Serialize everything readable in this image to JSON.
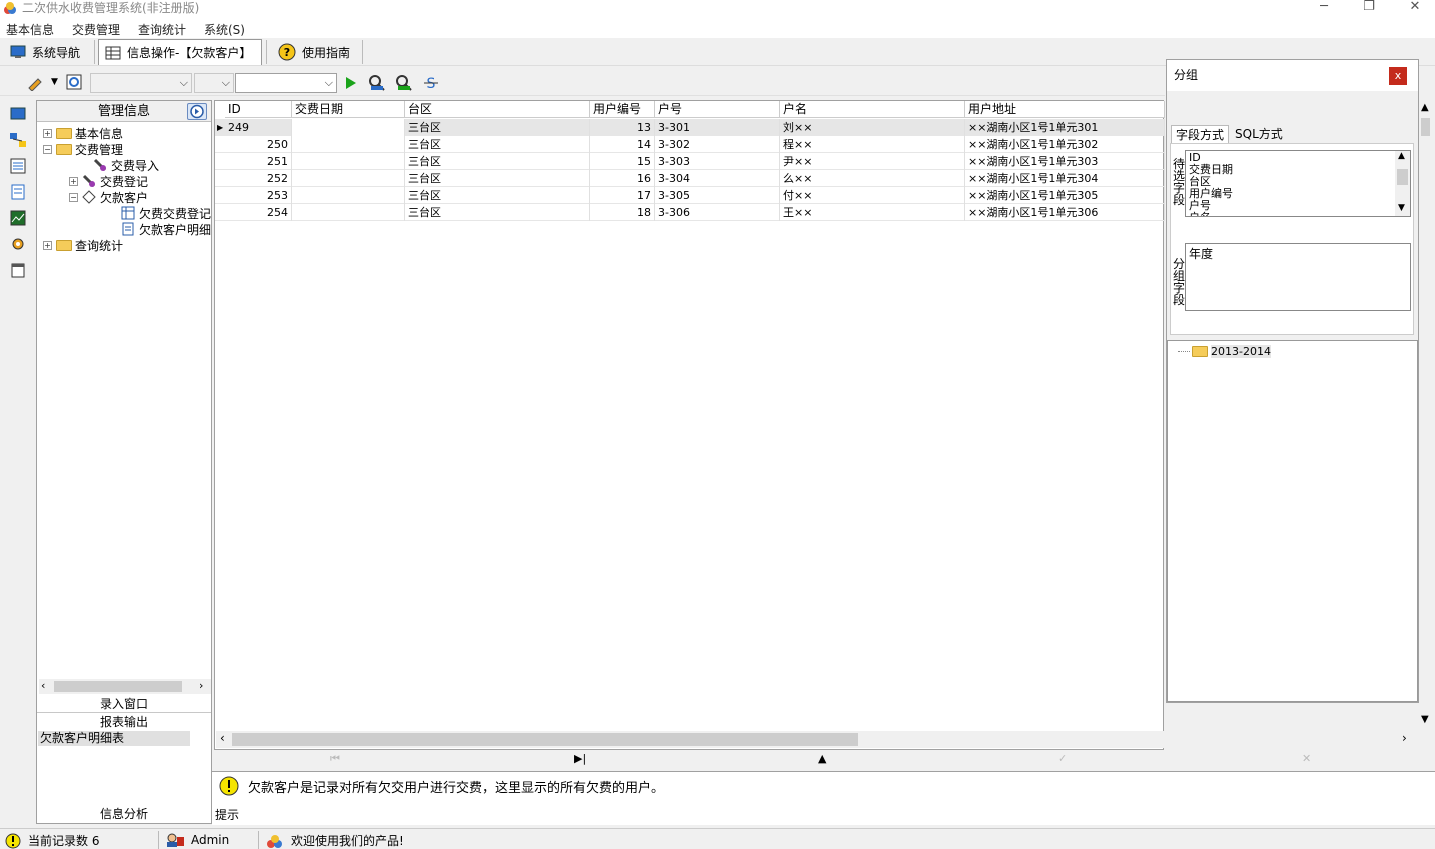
{
  "window": {
    "title": "二次供水收费管理系统(非注册版)",
    "minimize": "─",
    "maximize": "❐",
    "close": "✕"
  },
  "menu": [
    "基本信息",
    "交费管理",
    "查询统计",
    "系统(S)"
  ],
  "tabs": [
    {
      "label": "系统导航"
    },
    {
      "label": "信息操作-【欠款客户】"
    },
    {
      "label": "使用指南"
    }
  ],
  "nav": {
    "header": "管理信息",
    "tree": {
      "n1": "基本信息",
      "n2": "交费管理",
      "n2a": "交费导入",
      "n2b": "交费登记",
      "n2c": "欠款客户",
      "n2c1": "欠费交费登记",
      "n2c2": "欠款客户明细",
      "n3": "查询统计"
    },
    "section1": "录入窗口",
    "section2": "报表输出",
    "selected_report": "欠款客户明细表",
    "section3": "信息分析"
  },
  "grid": {
    "columns": [
      "ID",
      "交费日期",
      "台区",
      "用户编号",
      "户号",
      "户名",
      "用户地址"
    ],
    "rows": [
      {
        "id": "249",
        "date": "",
        "area": "三台区",
        "no": "13",
        "unit": "3-301",
        "name": "刘××",
        "addr": "××湖南小区1号1单元301"
      },
      {
        "id": "250",
        "date": "",
        "area": "三台区",
        "no": "14",
        "unit": "3-302",
        "name": "程××",
        "addr": "××湖南小区1号1单元302"
      },
      {
        "id": "251",
        "date": "",
        "area": "三台区",
        "no": "15",
        "unit": "3-303",
        "name": "尹××",
        "addr": "××湖南小区1号1单元303"
      },
      {
        "id": "252",
        "date": "",
        "area": "三台区",
        "no": "16",
        "unit": "3-304",
        "name": "么××",
        "addr": "××湖南小区1号1单元304"
      },
      {
        "id": "253",
        "date": "",
        "area": "三台区",
        "no": "17",
        "unit": "3-305",
        "name": "付××",
        "addr": "××湖南小区1号1单元305"
      },
      {
        "id": "254",
        "date": "",
        "area": "三台区",
        "no": "18",
        "unit": "3-306",
        "name": "王××",
        "addr": "××湖南小区1号1单元306"
      }
    ]
  },
  "hint": {
    "text": "欠款客户是记录对所有欠交用户进行交费，这里显示的所有欠费的用户。",
    "label": "提示"
  },
  "status": {
    "records": "当前记录数 6",
    "user": "Admin",
    "welcome": "欢迎使用我们的产品!"
  },
  "group": {
    "title": "分组",
    "close": "x",
    "tab1": "字段方式",
    "tab2": "SQL方式",
    "pending_label": "待选字段",
    "group_label": "分组字段",
    "fields": [
      "ID",
      "交费日期",
      "台区",
      "用户编号",
      "户号",
      "户名"
    ],
    "group_fields": [
      "年度"
    ],
    "tree_item": "2013-2014"
  },
  "colors": {
    "accent": "#c42b1c",
    "folder": "#f5cc5a",
    "run": "#1aa31a"
  }
}
